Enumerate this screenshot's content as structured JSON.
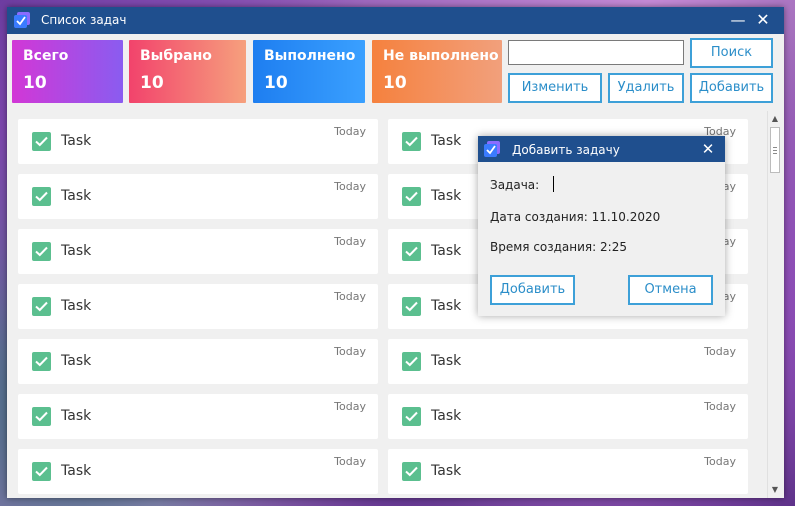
{
  "window": {
    "title": "Список задач",
    "minimize_glyph": "—",
    "close_glyph": "✕",
    "icon": "checklist-app-icon"
  },
  "stats": {
    "total": {
      "label": "Всего",
      "value": "10"
    },
    "selected": {
      "label": "Выбрано",
      "value": "10"
    },
    "done": {
      "label": "Выполнено",
      "value": "10"
    },
    "undone": {
      "label": "Не выполнено",
      "value": "10"
    }
  },
  "toolbar": {
    "search_value": "",
    "search_label": "Поиск",
    "edit_label": "Изменить",
    "delete_label": "Удалить",
    "add_label": "Добавить"
  },
  "tasks": [
    {
      "title": "Task",
      "date": "Today",
      "checked": true
    },
    {
      "title": "Task",
      "date": "Today",
      "checked": true
    },
    {
      "title": "Task",
      "date": "Today",
      "checked": true
    },
    {
      "title": "Task",
      "date": "Today",
      "checked": true
    },
    {
      "title": "Task",
      "date": "Today",
      "checked": true
    },
    {
      "title": "Task",
      "date": "Today",
      "checked": true
    },
    {
      "title": "Task",
      "date": "Today",
      "checked": true
    },
    {
      "title": "Task",
      "date": "Today",
      "checked": true
    },
    {
      "title": "Task",
      "date": "Today",
      "checked": true
    },
    {
      "title": "Task",
      "date": "Today",
      "checked": true
    },
    {
      "title": "Task",
      "date": "Today",
      "checked": true
    },
    {
      "title": "Task",
      "date": "Today",
      "checked": true
    },
    {
      "title": "Task",
      "date": "Today",
      "checked": true
    },
    {
      "title": "Task",
      "date": "Today",
      "checked": true
    }
  ],
  "dialog": {
    "title": "Добавить задачу",
    "close_glyph": "✕",
    "task_label": "Задача:",
    "task_value": "",
    "created_date_label": "Дата создания: 11.10.2020",
    "created_time_label": "Время создания: 2:25",
    "add_label": "Добавить",
    "cancel_label": "Отмена"
  },
  "colors": {
    "titlebar": "#1f4f8e",
    "accent_button": "#3da0d8",
    "checkbox": "#5bbf8f"
  }
}
